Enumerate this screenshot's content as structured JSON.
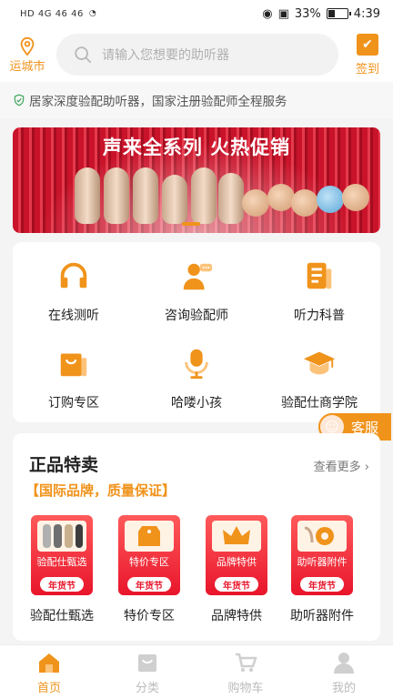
{
  "status_bar": {
    "left": "HD 4G 46 46",
    "battery": "33%",
    "time": "4:39",
    "battery_level": 0.33
  },
  "header": {
    "location": "运城市",
    "search_placeholder": "请输入您想要的助听器",
    "checkin": "签到"
  },
  "notice": "居家深度验配助听器，国家注册验配师全程服务",
  "banner": {
    "title": "声来全系列 火热促销"
  },
  "menu": [
    {
      "label": "在线测听",
      "icon": "headphones-icon"
    },
    {
      "label": "咨询验配师",
      "icon": "consultant-icon"
    },
    {
      "label": "听力科普",
      "icon": "article-icon"
    },
    {
      "label": "订购专区",
      "icon": "shopping-bag-icon"
    },
    {
      "label": "哈喽小孩",
      "icon": "microphone-icon"
    },
    {
      "label": "验配仕商学院",
      "icon": "graduation-cap-icon"
    }
  ],
  "service_button": "客服",
  "sale": {
    "title": "正品特卖",
    "more": "查看更多",
    "subtitle": "【国际品牌，质量保证】",
    "festival_tag": "年货节",
    "products": [
      {
        "tile_text": "验配仕甄选",
        "label": "验配仕甄选"
      },
      {
        "tile_text": "特价专区",
        "label": "特价专区"
      },
      {
        "tile_text": "品牌特供",
        "label": "品牌特供"
      },
      {
        "tile_text": "助听器附件",
        "label": "助听器附件"
      }
    ]
  },
  "tabbar": [
    {
      "label": "首页",
      "active": true
    },
    {
      "label": "分类",
      "active": false
    },
    {
      "label": "购物车",
      "active": false
    },
    {
      "label": "我的",
      "active": false
    }
  ],
  "colors": {
    "accent": "#f0931b",
    "banner_red": "#c9132a",
    "tile_red": "#e8152b"
  }
}
